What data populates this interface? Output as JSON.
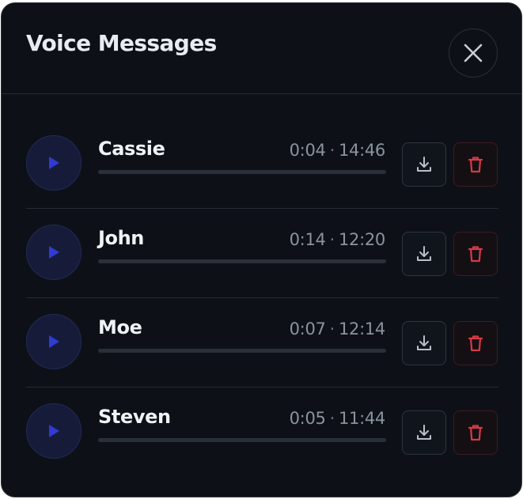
{
  "dialog": {
    "title": "Voice Messages",
    "close_icon": "close-icon"
  },
  "messages": [
    {
      "name": "Cassie",
      "duration": "0:04",
      "time": "14:46",
      "progress": 0
    },
    {
      "name": "John",
      "duration": "0:14",
      "time": "12:20",
      "progress": 0
    },
    {
      "name": "Moe",
      "duration": "0:07",
      "time": "12:14",
      "progress": 0
    },
    {
      "name": "Steven",
      "duration": "0:05",
      "time": "11:44",
      "progress": 0
    }
  ],
  "separator": "·",
  "icons": {
    "play": "play-icon",
    "download": "download-icon",
    "delete": "trash-icon"
  },
  "colors": {
    "background": "#0d1117",
    "play_accent": "#2f3bd1",
    "delete_accent": "#d63a47",
    "text_primary": "#f0f3f6",
    "text_secondary": "#8b939d"
  }
}
